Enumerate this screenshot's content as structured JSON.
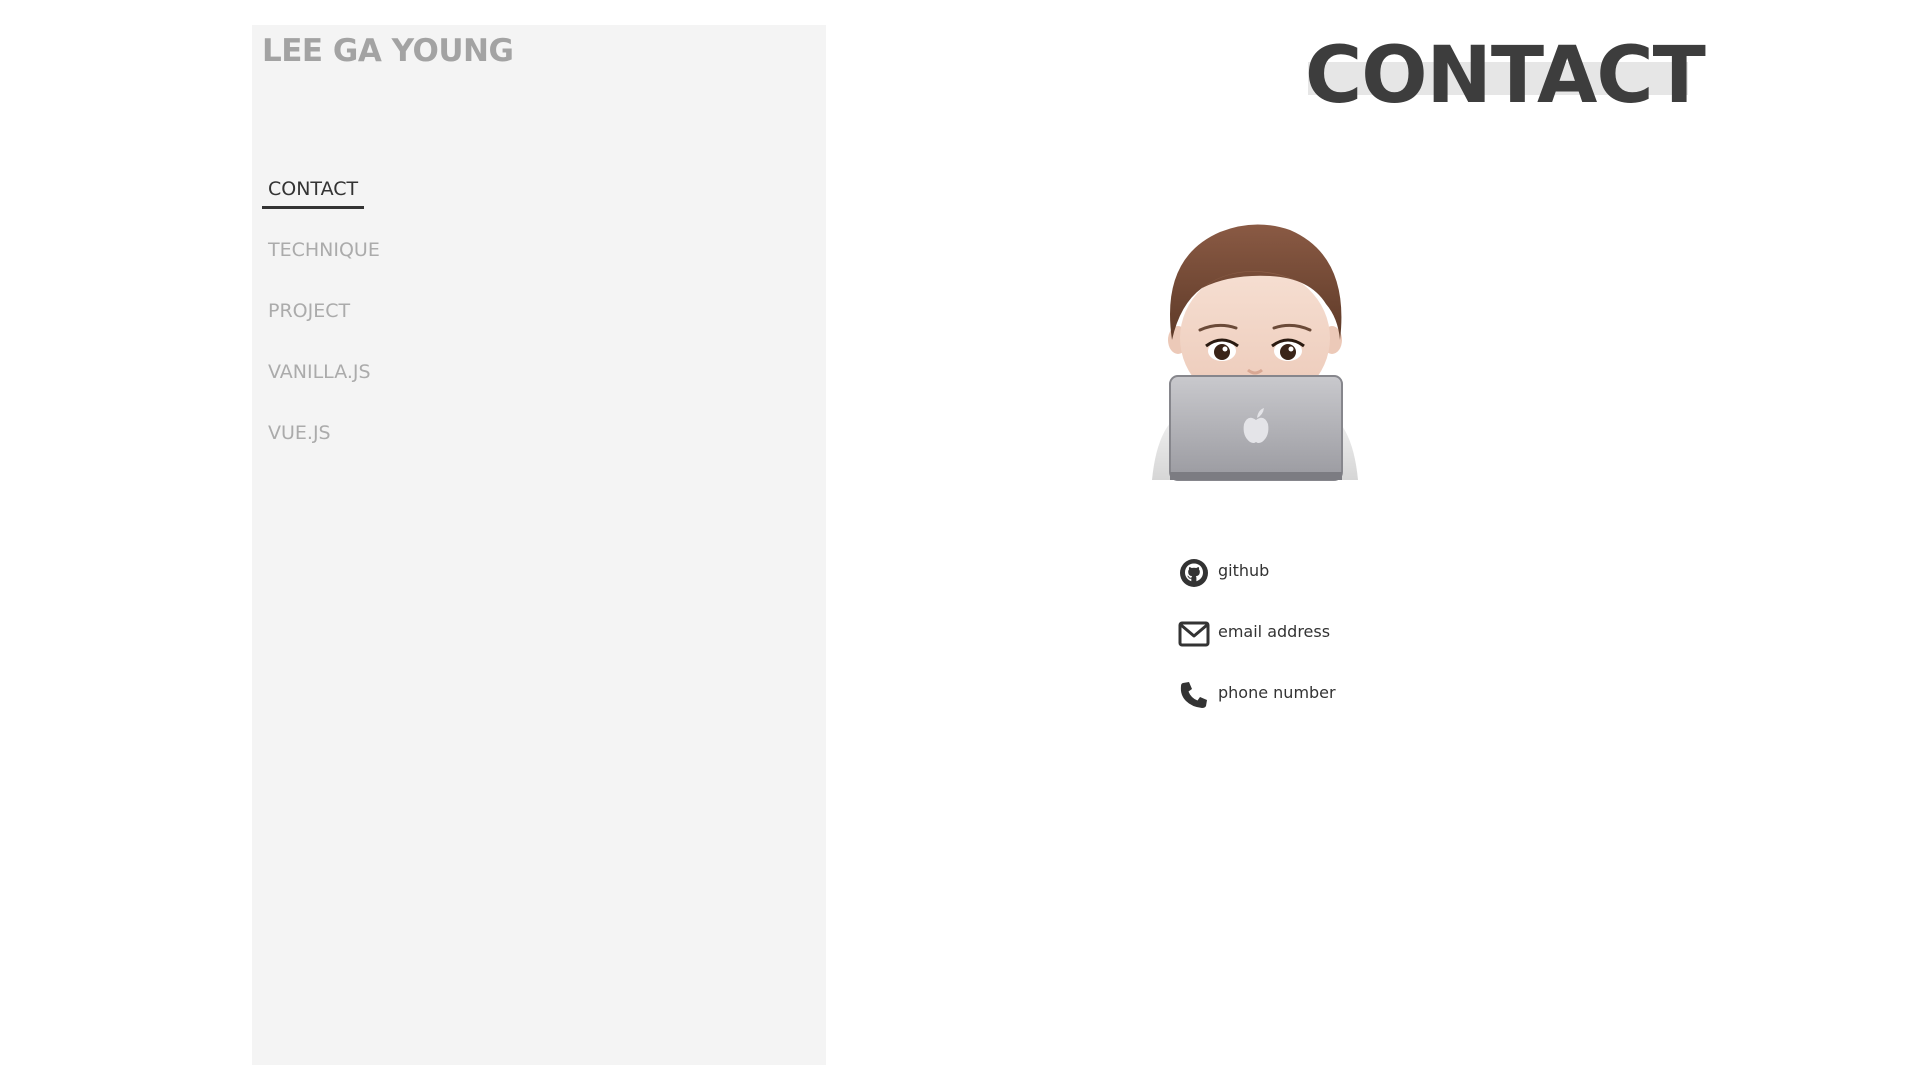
{
  "sidebar": {
    "title": "LEE GA YOUNG",
    "nav": [
      {
        "label": "CONTACT",
        "active": true
      },
      {
        "label": "TECHNIQUE",
        "active": false
      },
      {
        "label": "PROJECT",
        "active": false
      },
      {
        "label": "VANILLA.JS",
        "active": false
      },
      {
        "label": "VUE.JS",
        "active": false
      }
    ]
  },
  "main": {
    "heading": "CONTACT",
    "avatar_icon": "memoji-laptop-avatar",
    "contacts": [
      {
        "icon": "github-icon",
        "label": "github"
      },
      {
        "icon": "envelope-icon",
        "label": "email address"
      },
      {
        "icon": "phone-icon",
        "label": "phone number"
      }
    ]
  },
  "colors": {
    "sidebar_bg": "#f4f4f4",
    "title_gray": "#a3a3a3",
    "nav_inactive": "#ababab",
    "text_dark": "#333333",
    "heading_highlight": "#e6e6e6"
  }
}
